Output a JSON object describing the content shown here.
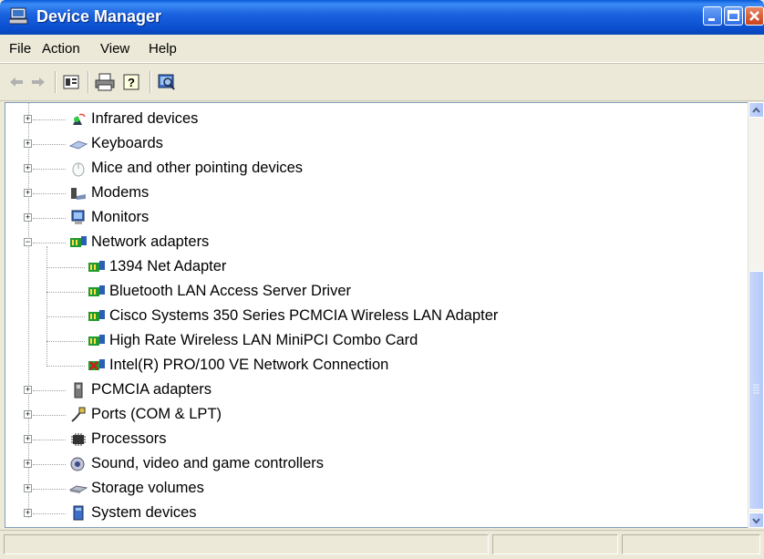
{
  "window": {
    "title": "Device Manager"
  },
  "menu": {
    "items": [
      "File",
      "Action",
      "View",
      "Help"
    ]
  },
  "toolbar": {
    "buttons": [
      "back-icon",
      "forward-icon",
      "properties-icon",
      "print-icon",
      "help-icon",
      "scan-hardware-icon"
    ]
  },
  "tree": {
    "categories": [
      {
        "label": "Infrared devices",
        "icon": "infrared-icon",
        "expanded": false
      },
      {
        "label": "Keyboards",
        "icon": "keyboard-icon",
        "expanded": false
      },
      {
        "label": "Mice and other pointing devices",
        "icon": "mouse-icon",
        "expanded": false
      },
      {
        "label": "Modems",
        "icon": "modem-icon",
        "expanded": false
      },
      {
        "label": "Monitors",
        "icon": "monitor-icon",
        "expanded": false
      },
      {
        "label": "Network adapters",
        "icon": "network-adapter-icon",
        "expanded": true
      },
      {
        "label": "PCMCIA adapters",
        "icon": "pcmcia-icon",
        "expanded": false
      },
      {
        "label": "Ports (COM & LPT)",
        "icon": "port-icon",
        "expanded": false
      },
      {
        "label": "Processors",
        "icon": "processor-icon",
        "expanded": false
      },
      {
        "label": "Sound, video and game controllers",
        "icon": "sound-icon",
        "expanded": false
      },
      {
        "label": "Storage volumes",
        "icon": "storage-icon",
        "expanded": false
      },
      {
        "label": "System devices",
        "icon": "system-icon",
        "expanded": false
      }
    ],
    "network_children": [
      {
        "label": "1394 Net Adapter",
        "icon": "network-adapter-icon",
        "disabled": false
      },
      {
        "label": "Bluetooth LAN Access Server Driver",
        "icon": "network-adapter-icon",
        "disabled": false
      },
      {
        "label": "Cisco Systems 350 Series PCMCIA Wireless LAN Adapter",
        "icon": "network-adapter-icon",
        "disabled": false
      },
      {
        "label": "High Rate Wireless LAN MiniPCI Combo Card",
        "icon": "network-adapter-icon",
        "disabled": false
      },
      {
        "label": "Intel(R) PRO/100 VE Network Connection",
        "icon": "network-adapter-disabled-icon",
        "disabled": true
      }
    ]
  },
  "colors": {
    "titlebar": "#0a4fcf",
    "selection": "#316ac5",
    "adapter_green": "#1f9a2e",
    "disabled_red": "#d11a1a"
  }
}
